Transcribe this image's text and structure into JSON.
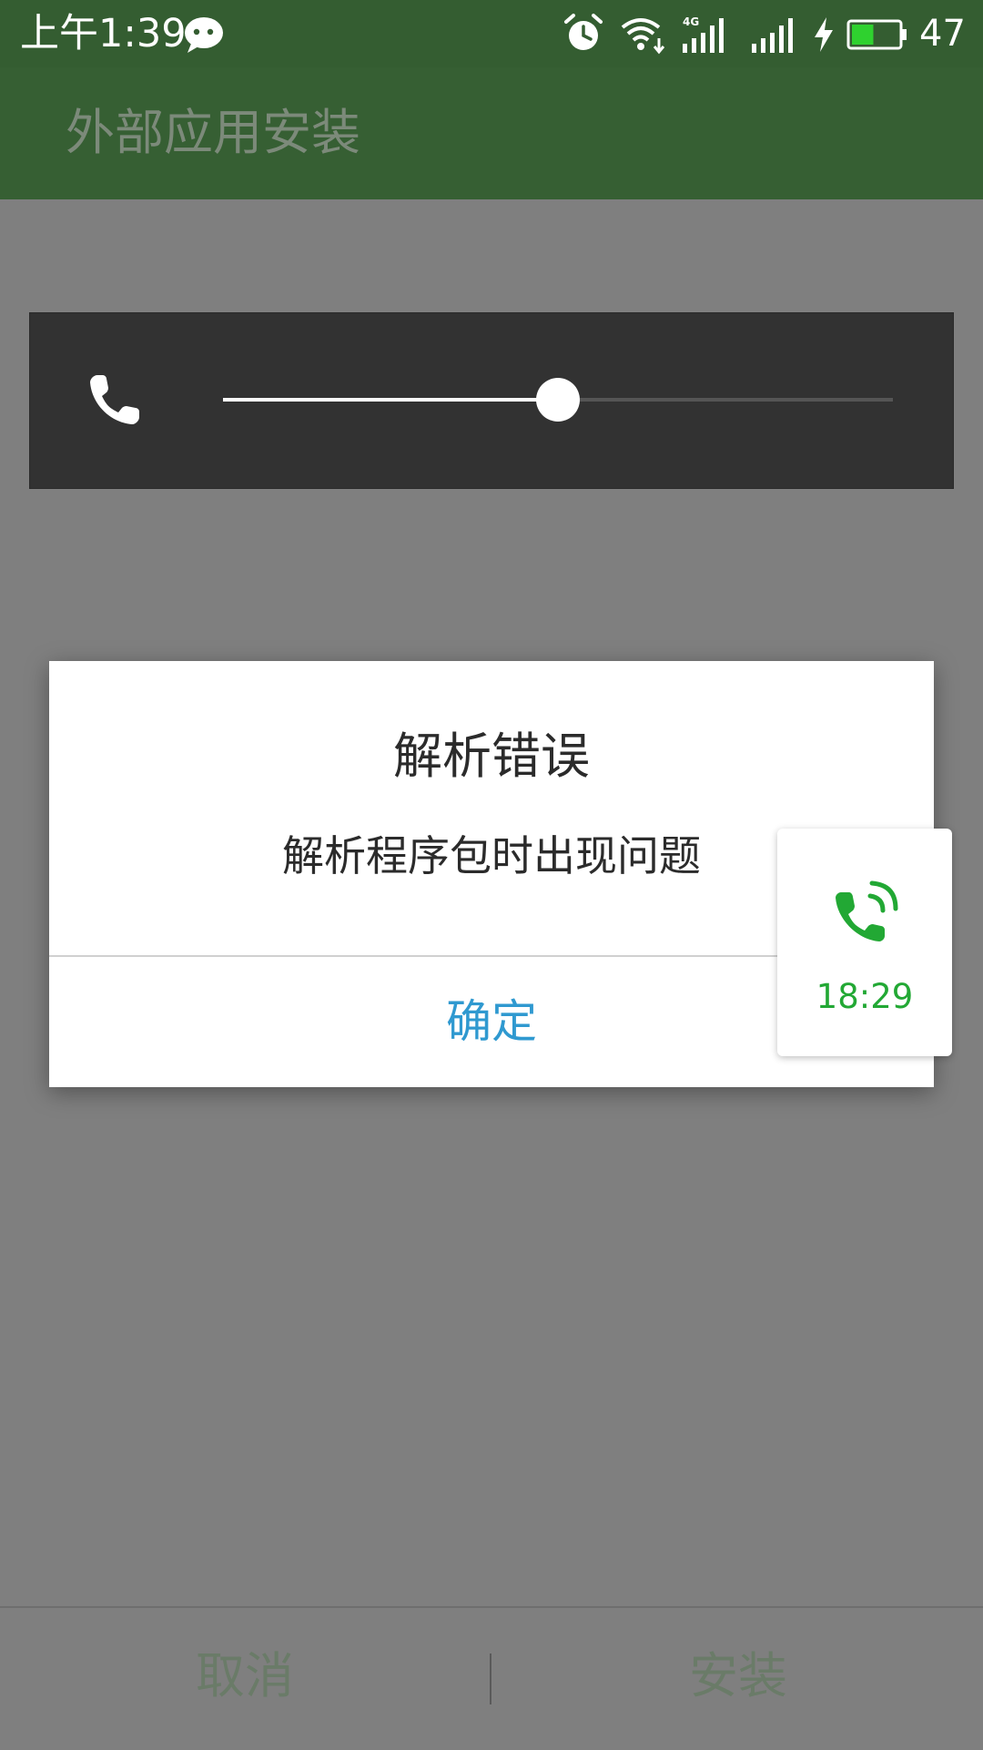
{
  "status_bar": {
    "time": "上午1:39",
    "battery_percent": "47",
    "battery_level": 0.47,
    "icons": [
      "chat-bubble-icon",
      "alarm-icon",
      "wifi-icon",
      "signal-4g-icon",
      "signal-icon",
      "charging-bolt-icon",
      "battery-icon"
    ]
  },
  "app_bar": {
    "title": "外部应用安装"
  },
  "volume_panel": {
    "icon": "phone-icon",
    "level": 0.5
  },
  "dialog": {
    "title": "解析错误",
    "message": "解析程序包时出现问题",
    "confirm_label": "确定"
  },
  "call_card": {
    "icon": "phone-call-icon",
    "duration": "18:29"
  },
  "bottom_bar": {
    "cancel_label": "取消",
    "install_label": "安装"
  },
  "colors": {
    "status_bar": "#345d31",
    "app_bar": "#365f33",
    "dialog_button": "#2f99d0",
    "call_accent": "#22a834",
    "scrim": "#7f7f7f"
  }
}
